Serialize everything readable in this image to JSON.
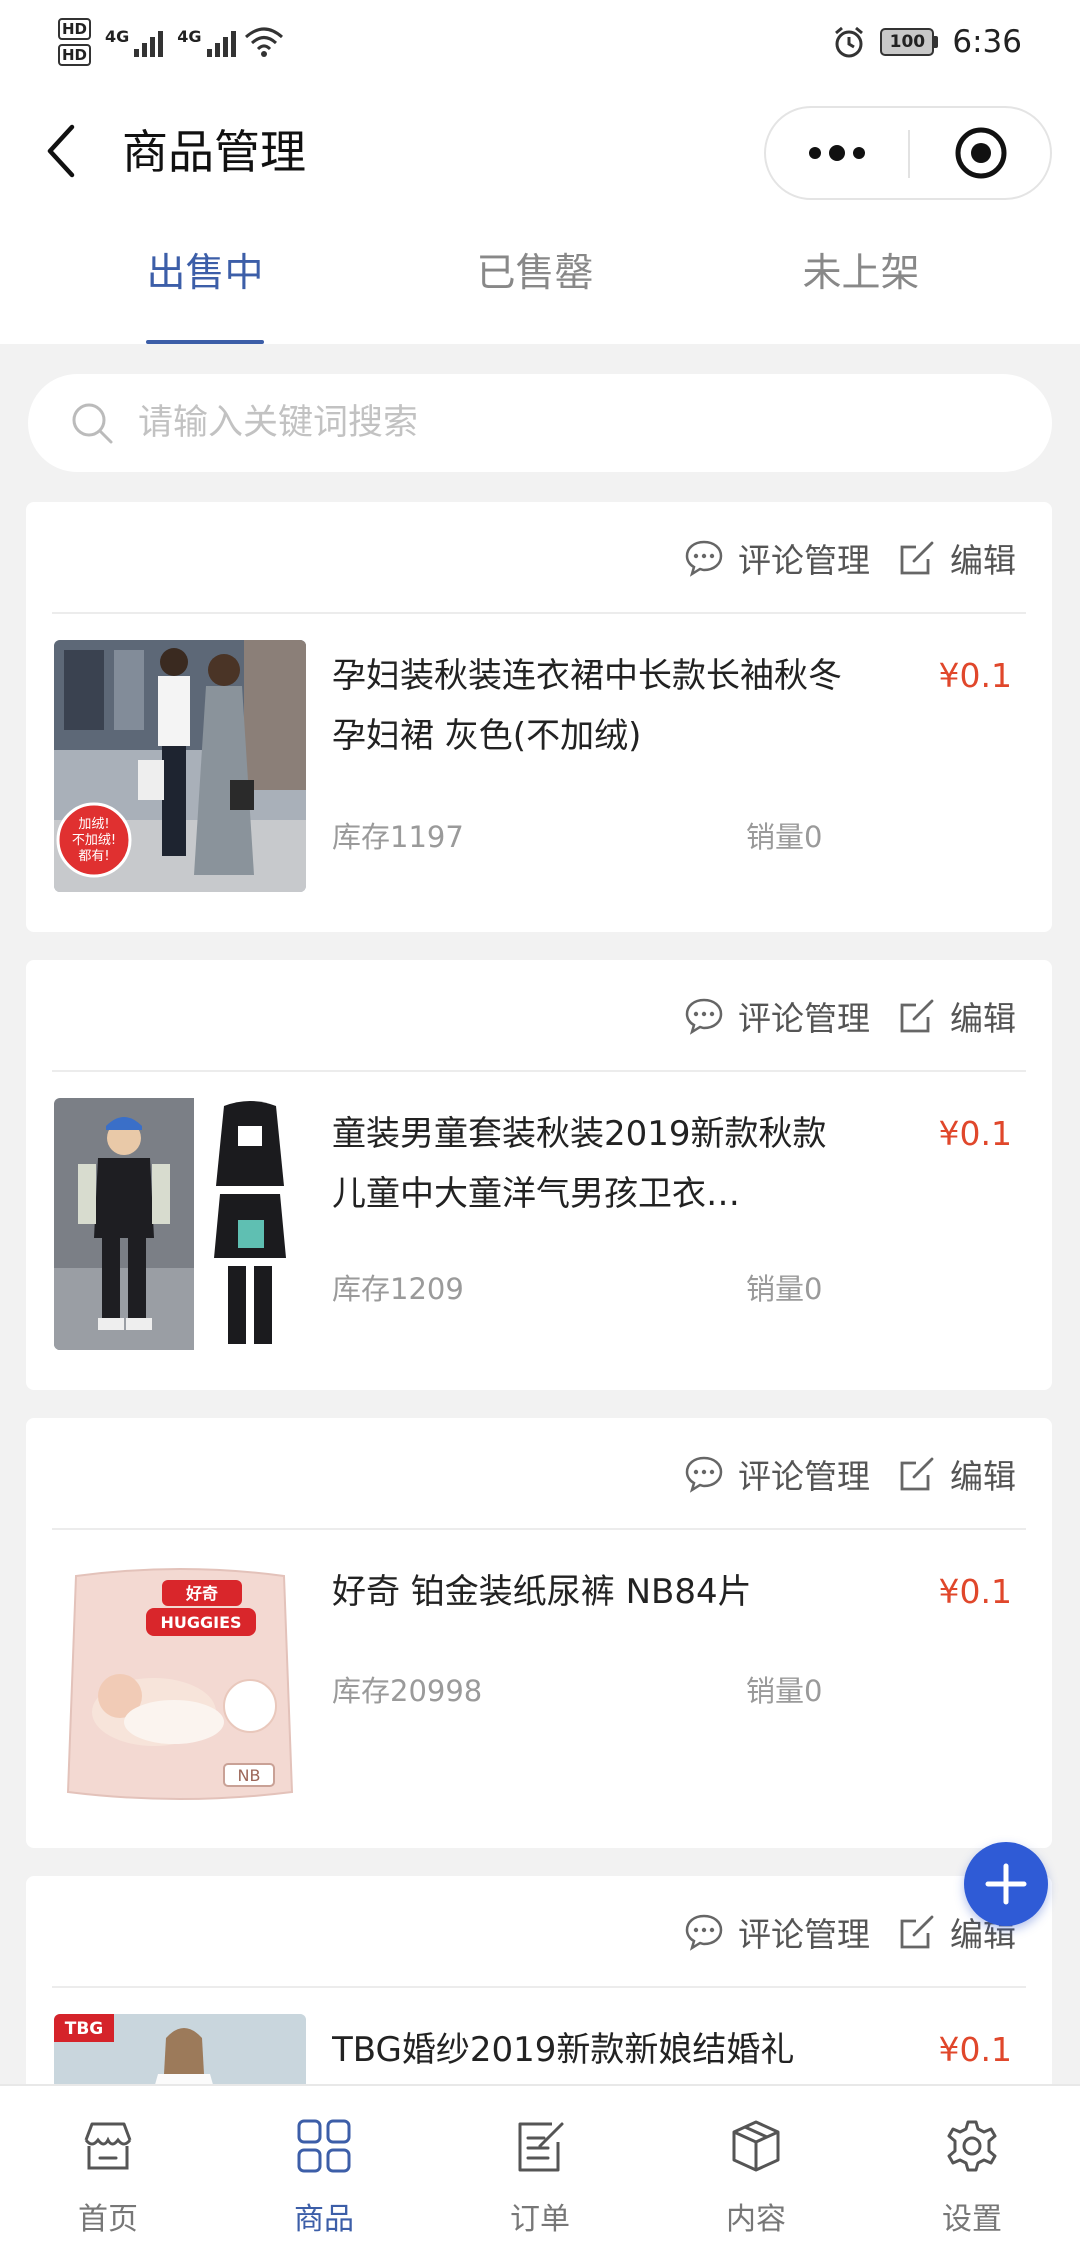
{
  "status_bar": {
    "hd1": "HD",
    "hd2": "HD",
    "net1": "4G",
    "net2": "4G",
    "battery": "100",
    "time": "6:36"
  },
  "nav": {
    "title": "商品管理"
  },
  "tabs": [
    {
      "label": "出售中",
      "active": true
    },
    {
      "label": "已售罄",
      "active": false
    },
    {
      "label": "未上架",
      "active": false
    }
  ],
  "search": {
    "placeholder": "请输入关键词搜索",
    "value": ""
  },
  "card_actions": {
    "comment": "评论管理",
    "edit": "编辑"
  },
  "products": [
    {
      "name": "孕妇装秋装连衣裙中长款长袖秋冬孕妇裙 灰色(不加绒)",
      "price": "¥0.1",
      "stock": "库存1197",
      "sales": "销量0",
      "image_badge": "加绒!不加绒!都有!"
    },
    {
      "name": "童装男童套装秋装2019新款秋款儿童中大童洋气男孩卫衣…",
      "price": "¥0.1",
      "stock": "库存1209",
      "sales": "销量0"
    },
    {
      "name": "好奇 铂金装纸尿裤 NB84片",
      "price": "¥0.1",
      "stock": "库存20998",
      "sales": "销量0",
      "image_brand": "HUGGIES",
      "image_brand_cn": "好奇",
      "image_size": "NB"
    },
    {
      "name": "TBG婚纱2019新款新娘结婚礼",
      "price": "¥0.1",
      "image_badge": "TBG"
    }
  ],
  "tabbar": [
    {
      "label": "首页",
      "icon": "store-icon",
      "active": false
    },
    {
      "label": "商品",
      "icon": "grid-icon",
      "active": true
    },
    {
      "label": "订单",
      "icon": "order-icon",
      "active": false
    },
    {
      "label": "内容",
      "icon": "box-icon",
      "active": false
    },
    {
      "label": "设置",
      "icon": "gear-icon",
      "active": false
    }
  ],
  "colors": {
    "accent": "#3c5ea8",
    "price": "#e0472b",
    "fab": "#2f5bd6",
    "background": "#f2f2f2"
  }
}
